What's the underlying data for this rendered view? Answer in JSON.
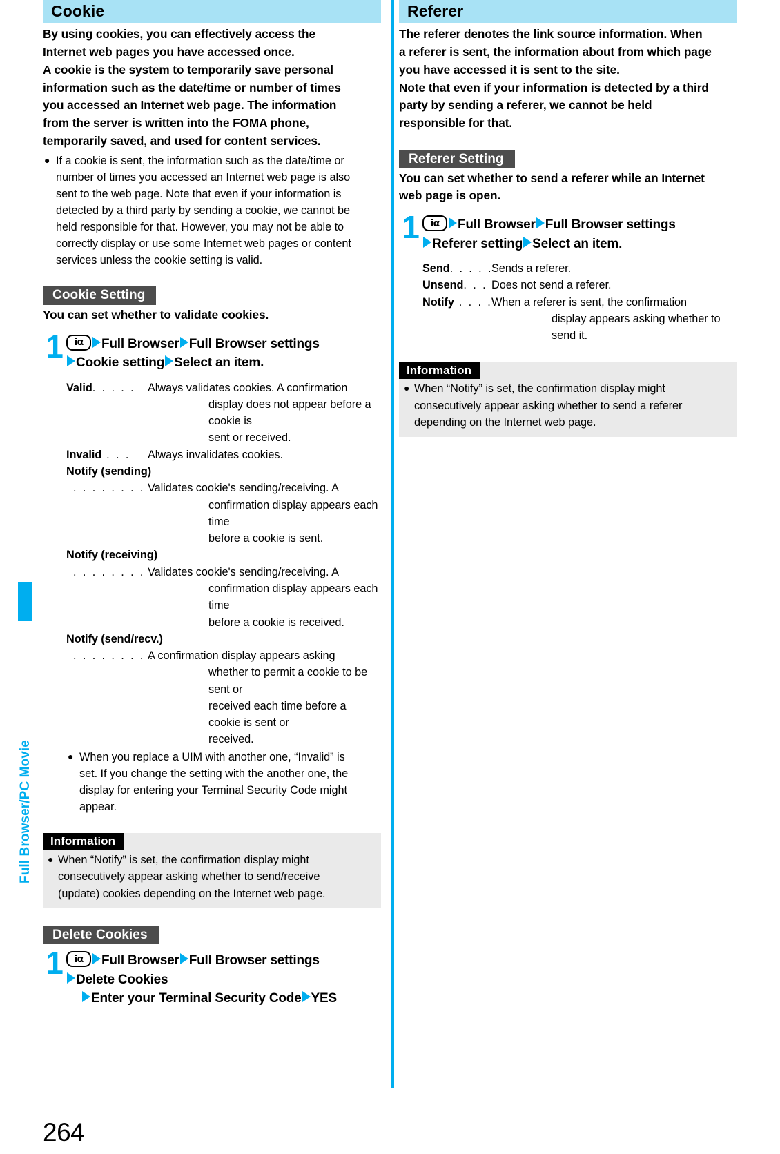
{
  "page_number": "264",
  "side_tab": {
    "label": "Full Browser/PC Movie"
  },
  "icons": {
    "imode_key_glyph": "iα",
    "bullet": "●",
    "arrow": "▶"
  },
  "colors": {
    "accent_cyan": "#00AEEF",
    "section_head_bg": "#A8E2F5",
    "sub_head_bg": "#4D4D4D",
    "info_label_bg": "#000000",
    "info_box_bg": "#EAEAEA"
  },
  "left_column": {
    "section_title": "Cookie",
    "intro_lines": [
      "By using cookies, you can effectively access the",
      "Internet web pages you have accessed once.",
      "A cookie is the system to temporarily save personal",
      "information such as the date/time or number of times",
      "you accessed an Internet web page. The information",
      "from the server is written into the FOMA phone,",
      "temporarily saved, and used for content services."
    ],
    "intro_bullet_lines": [
      "If a cookie is sent, the information such as the date/time or",
      "number of times you accessed an Internet web page is also",
      "sent to the web page. Note that even if your information is",
      "detected by a third party by sending a cookie, we cannot be",
      "held responsible for that. However, you may not be able to",
      "correctly display or use some Internet web pages or content",
      "services unless the cookie setting is valid."
    ],
    "cookie_setting": {
      "heading": "Cookie Setting",
      "lead_lines": [
        "You can set whether to validate cookies."
      ],
      "step_number": "1",
      "step_lines": [
        "Full Browser",
        "Full Browser settings",
        "Cookie setting",
        "Select an item."
      ],
      "options": [
        {
          "term": "Valid",
          "leader": ". . . . .",
          "def_lines": [
            "Always validates cookies. A confirmation",
            "display does not appear before a cookie is",
            "sent or received."
          ]
        },
        {
          "term": "Invalid",
          "leader": " . . .",
          "def_lines": [
            "Always invalidates cookies."
          ]
        },
        {
          "term": "Notify (sending)",
          "leader": ". . . . . . . . .",
          "def_lines": [
            "Validates cookie's sending/receiving. A",
            "confirmation display appears each time",
            "before a cookie is sent."
          ]
        },
        {
          "term": "Notify (receiving)",
          "leader": ". . . . . . . . .",
          "def_lines": [
            "Validates cookie's sending/receiving. A",
            "confirmation display appears each time",
            "before a cookie is received."
          ]
        },
        {
          "term": "Notify (send/recv.)",
          "leader": ". . . . . . . . .",
          "def_lines": [
            "A confirmation display appears asking",
            "whether to permit a cookie to be sent or",
            "received each time before a cookie is sent or",
            "received."
          ]
        }
      ],
      "note_bullet_lines": [
        "When you replace a UIM with another one, “Invalid” is",
        "set. If you change the setting with the another one, the",
        "display for entering your Terminal Security Code might",
        "appear."
      ]
    },
    "information": {
      "label": "Information",
      "lines": [
        "When “Notify” is set, the confirmation display might",
        "consecutively appear asking whether to send/receive",
        "(update) cookies depending on the Internet web page."
      ]
    },
    "delete_cookies": {
      "heading": "Delete Cookies",
      "step_number": "1",
      "step_lines": [
        "Full Browser",
        "Full Browser settings",
        "Delete Cookies",
        "Enter your Terminal Security Code",
        "YES"
      ]
    }
  },
  "right_column": {
    "section_title": "Referer",
    "intro_lines": [
      "The referer denotes the link source information. When",
      "a referer is sent, the information about from which page",
      "you have accessed it is sent to the site.",
      "Note that even if your information is detected by a third",
      "party by sending a referer, we cannot be held",
      "responsible for that."
    ],
    "referer_setting": {
      "heading": "Referer Setting",
      "lead_lines": [
        "You can set whether to send a referer while an Internet",
        "web page is open."
      ],
      "step_number": "1",
      "step_lines": [
        "Full Browser",
        "Full Browser settings",
        "Referer setting",
        "Select an item."
      ],
      "options": [
        {
          "term": "Send",
          "leader": ". . . . .",
          "def_lines": [
            "Sends a referer."
          ]
        },
        {
          "term": "Unsend",
          "leader": ". . .",
          "def_lines": [
            "Does not send a referer."
          ]
        },
        {
          "term": "Notify",
          "leader": " . . . .",
          "def_lines": [
            "When a referer is sent, the confirmation",
            "display appears asking whether to send it."
          ]
        }
      ]
    },
    "information": {
      "label": "Information",
      "lines": [
        "When “Notify” is set, the confirmation display might",
        "consecutively appear asking whether to send a referer",
        "depending on the Internet web page."
      ]
    }
  }
}
